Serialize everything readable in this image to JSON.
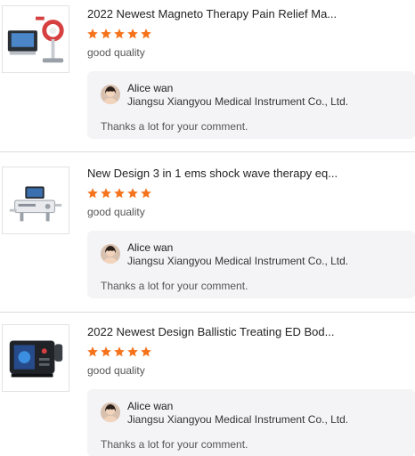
{
  "reviews": [
    {
      "product_title": "2022 Newest Magneto Therapy Pain Relief Ma...",
      "rating": 5,
      "rating_comment": "good quality",
      "reply": {
        "author": "Alice wan",
        "company": "Jiangsu Xiangyou Medical Instrument Co., Ltd.",
        "text": "Thanks a lot for your comment."
      }
    },
    {
      "product_title": "New Design 3 in 1 ems shock wave therapy eq...",
      "rating": 5,
      "rating_comment": "good quality",
      "reply": {
        "author": "Alice wan",
        "company": "Jiangsu Xiangyou Medical Instrument Co., Ltd.",
        "text": "Thanks a lot for your comment."
      }
    },
    {
      "product_title": "2022 Newest Design Ballistic Treating ED Bod...",
      "rating": 5,
      "rating_comment": "good quality",
      "reply": {
        "author": "Alice wan",
        "company": "Jiangsu Xiangyou Medical Instrument Co., Ltd.",
        "text": "Thanks a lot for your comment."
      }
    }
  ],
  "colors": {
    "star": "#f5731c",
    "reply_bg": "#f4f4f6",
    "separator": "#dcdcdc"
  },
  "icons": {
    "star": "star-icon",
    "product_image": "product-image",
    "avatar": "avatar"
  }
}
